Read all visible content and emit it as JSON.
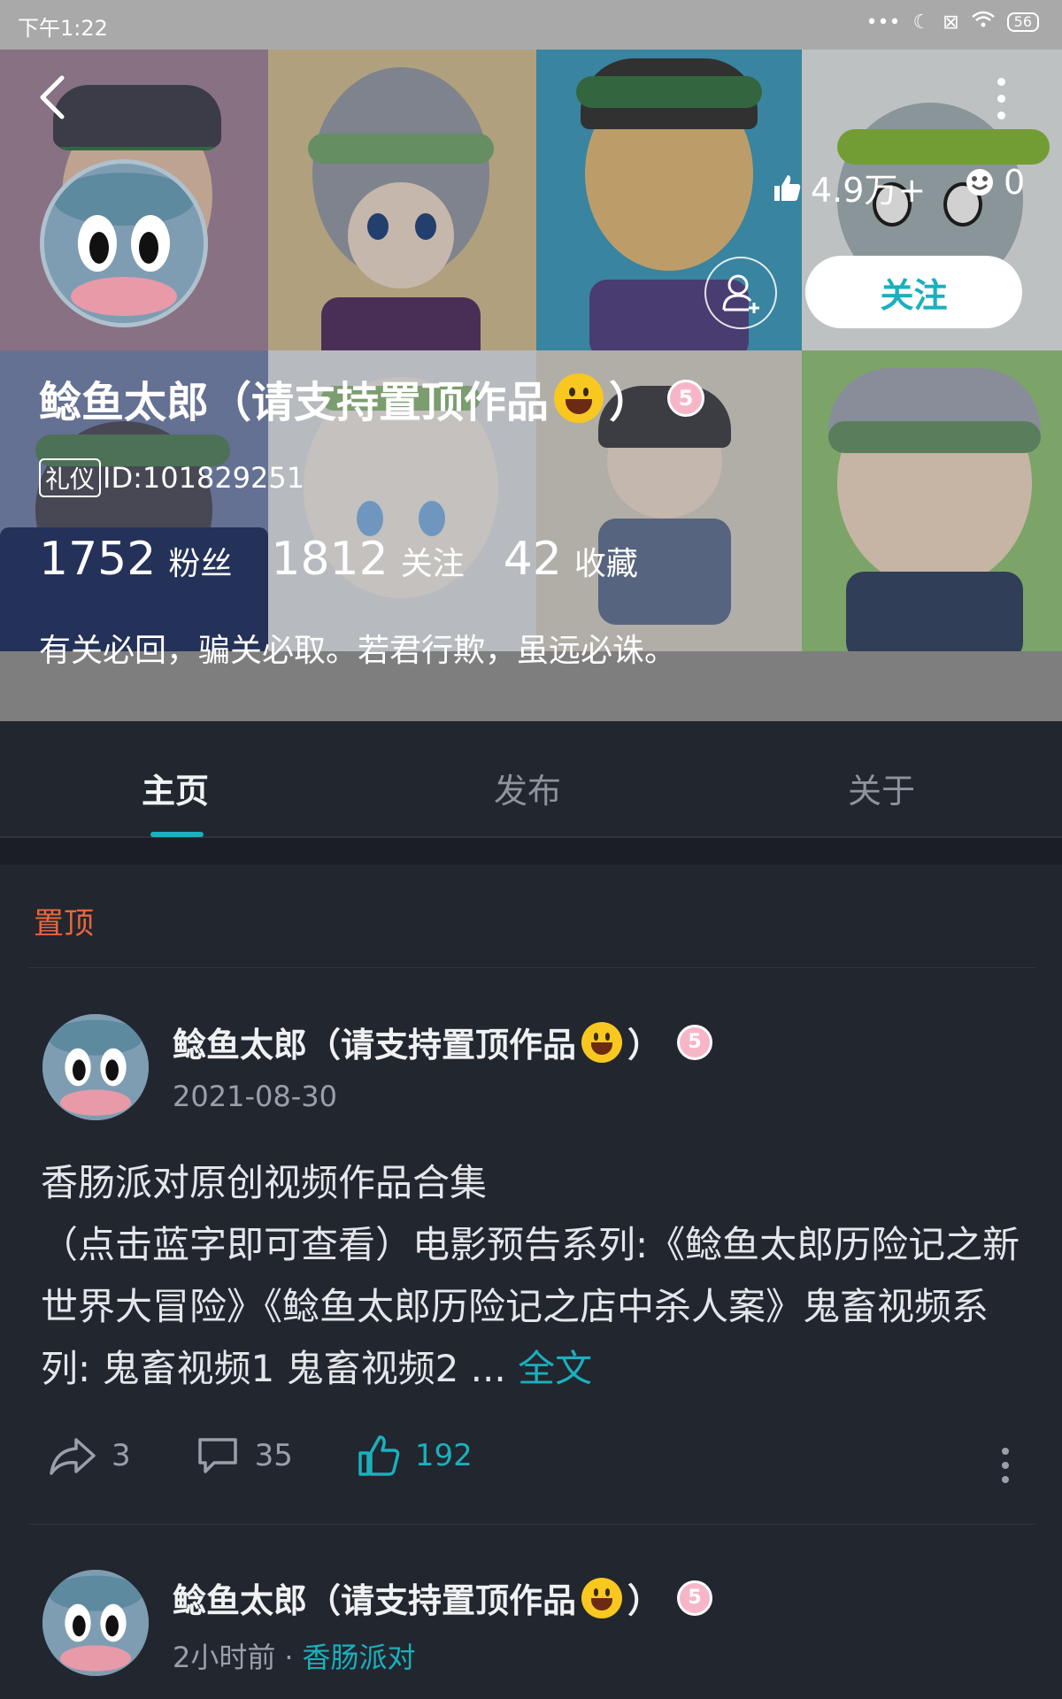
{
  "status_bar": {
    "time": "下午1:22",
    "battery": "56"
  },
  "profile": {
    "name": "鲶鱼太郎（请支持置顶作品",
    "name_suffix": "）",
    "level": "5",
    "id_badge": "礼仪",
    "id_text": "ID:101829251",
    "likes": "4.9万+",
    "smiles": "0",
    "follow_label": "关注",
    "stats": [
      {
        "num": "1752",
        "label": "粉丝"
      },
      {
        "num": "1812",
        "label": "关注"
      },
      {
        "num": "42",
        "label": "收藏"
      }
    ],
    "bio": "有关必回，骗关必取。若君行欺，虽远必诛。"
  },
  "tabs": [
    {
      "label": "主页",
      "active": true
    },
    {
      "label": "发布",
      "active": false
    },
    {
      "label": "关于",
      "active": false
    }
  ],
  "pinned_label": "置顶",
  "posts": [
    {
      "author": "鲶鱼太郎（请支持置顶作品",
      "author_suffix": "）",
      "level": "5",
      "date": "2021-08-30",
      "body_line1": "香肠派对原创视频作品合集",
      "body_rest": "（点击蓝字即可查看）电影预告系列:《鲶鱼太郎历险记之新世界大冒险》《鲶鱼太郎历险记之店中杀人案》鬼畜视频系列: 鬼畜视频1 鬼畜视频2  ... ",
      "more_label": "全文",
      "shares": "3",
      "comments": "35",
      "likes": "192"
    },
    {
      "author": "鲶鱼太郎（请支持置顶作品",
      "author_suffix": "）",
      "level": "5",
      "time": "2小时前",
      "separator": "·",
      "topic": "香肠派对"
    }
  ]
}
